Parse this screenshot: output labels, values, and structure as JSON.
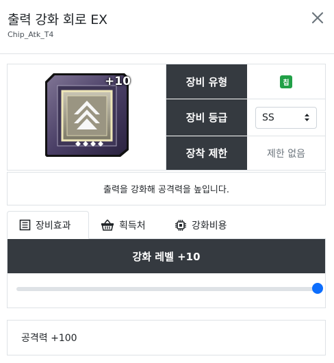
{
  "header": {
    "title": "출력 강화 회로 EX",
    "subtitle": "Chip_Atk_T4"
  },
  "item": {
    "enhance_overlay": "+10",
    "rows": [
      {
        "label": "장비 유형",
        "value": "칩"
      },
      {
        "label": "장비 등급",
        "value": "SS"
      },
      {
        "label": "장착 제한",
        "value": "제한 없음"
      }
    ],
    "description": "출력을 강화해 공격력을 높입니다."
  },
  "tabs": [
    {
      "label": "장비효과",
      "icon": "document-list-icon",
      "active": true
    },
    {
      "label": "획득처",
      "icon": "basket-icon",
      "active": false
    },
    {
      "label": "강화비용",
      "icon": "chip-icon",
      "active": false
    }
  ],
  "enhance": {
    "title": "강화 레벨 +10",
    "level_fraction": 1.0
  },
  "stats": {
    "line": "공격력 +100"
  },
  "colors": {
    "dark_header": "#353a40",
    "badge_green": "#21a047",
    "slider_blue": "#0d6efd"
  }
}
